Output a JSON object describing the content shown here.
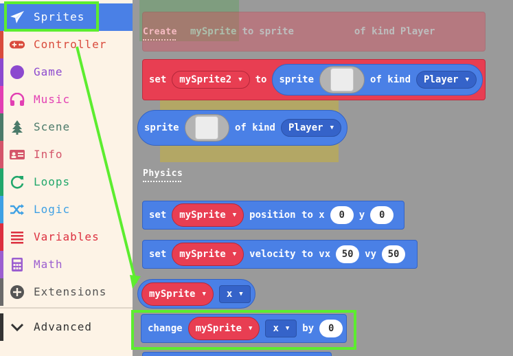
{
  "sidebar": {
    "categories": [
      {
        "label": "Sprites",
        "color": "#4a80e6",
        "icon": "paper-plane-icon",
        "selected": true
      },
      {
        "label": "Controller",
        "color": "#d94a3c",
        "icon": "gamepad-icon"
      },
      {
        "label": "Game",
        "color": "#8c49cf",
        "icon": "circle-icon"
      },
      {
        "label": "Music",
        "color": "#e23fb3",
        "icon": "headphones-icon"
      },
      {
        "label": "Scene",
        "color": "#4b7a6a",
        "icon": "tree-icon"
      },
      {
        "label": "Info",
        "color": "#d4556a",
        "icon": "id-card-icon"
      },
      {
        "label": "Loops",
        "color": "#21a76b",
        "icon": "loop-icon"
      },
      {
        "label": "Logic",
        "color": "#3ea0e4",
        "icon": "shuffle-icon"
      },
      {
        "label": "Variables",
        "color": "#dc2f3f",
        "icon": "list-icon"
      },
      {
        "label": "Math",
        "color": "#9b5ed0",
        "icon": "calculator-icon"
      },
      {
        "label": "Extensions",
        "color": "#6a6a6a",
        "icon": "plus-circle-icon"
      },
      {
        "label": "Advanced",
        "color": "#333333",
        "icon": "chevron-down-icon"
      }
    ]
  },
  "workspace": {
    "sections": {
      "create": "Create",
      "physics": "Physics"
    },
    "ghost_block": {
      "set": "set",
      "var": "mySprite",
      "to": "to",
      "sprite": "sprite",
      "of_kind": "of kind",
      "kind": "Player"
    },
    "set_block": {
      "set": "set",
      "var": "mySprite2",
      "to": "to",
      "sprite": "sprite",
      "of_kind": "of kind",
      "kind": "Player"
    },
    "sprite_reporter": {
      "sprite": "sprite",
      "of_kind": "of kind",
      "kind": "Player"
    },
    "position_block": {
      "set": "set",
      "var": "mySprite",
      "label": "position to x",
      "x": "0",
      "y_label": "y",
      "y": "0"
    },
    "velocity_block": {
      "set": "set",
      "var": "mySprite",
      "label": "velocity to vx",
      "vx": "50",
      "vy_label": "vy",
      "vy": "50"
    },
    "prop_reporter": {
      "var": "mySprite",
      "prop": "x"
    },
    "change_block": {
      "change": "change",
      "var": "mySprite",
      "prop": "x",
      "by": "by",
      "value": "0"
    }
  },
  "annotation_color": "#5ced2f"
}
